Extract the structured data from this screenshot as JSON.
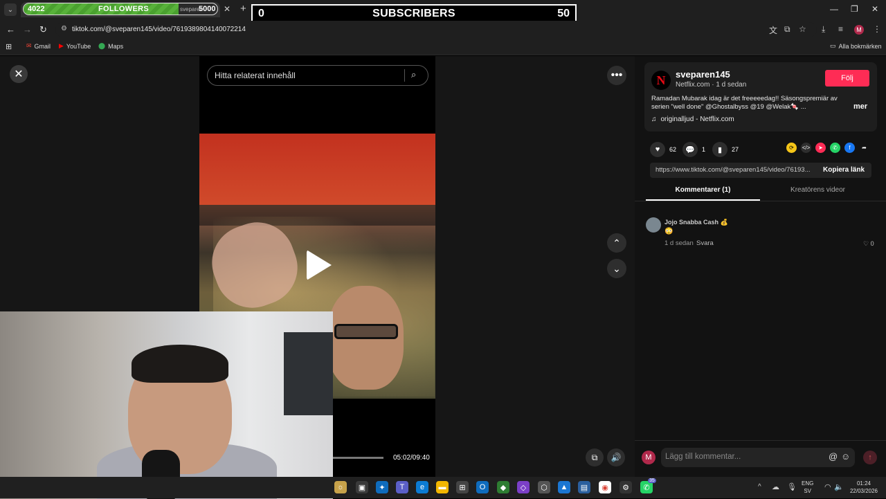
{
  "browser": {
    "overlay_followers": {
      "count": "4022",
      "label": "FOLLOWERS",
      "tab_ghost_text": "sveparen",
      "goal": "5000",
      "progress_fraction": 0.8
    },
    "overlay_subscribers": {
      "count": "0",
      "label": "SUBSCRIBERS",
      "goal": "50"
    },
    "url": "tiktok.com/@sveparen145/video/7619389804140072214",
    "bookmarks": [
      {
        "label": "Gmail",
        "icon": "gmail-icon"
      },
      {
        "label": "YouTube",
        "icon": "youtube-icon"
      },
      {
        "label": "Maps",
        "icon": "maps-icon"
      }
    ],
    "all_bookmarks": "Alla bokmärken",
    "profile_initial": "M"
  },
  "video": {
    "search_placeholder": "Hitta relaterat innehåll",
    "time": "05:02/09:40",
    "progress_fraction": 0.52
  },
  "post": {
    "username": "sveparen145",
    "subline": "Netflix.com · 1 d sedan",
    "follow_label": "Följ",
    "description": "Ramadan Mubarak idag är det freeeeedag!! Säsongspremiär av serien \"well done\" @Ghostalbyss @19 @Welak🍬 ...",
    "more_label": "mer",
    "music": "originalljud - Netflix.com",
    "likes": "62",
    "comments": "1",
    "saves": "27",
    "link": "https://www.tiktok.com/@sveparen145/video/76193...",
    "copy_link_label": "Kopiera länk",
    "tab_comments": "Kommentarer (1)",
    "tab_creator": "Kreatörens videor"
  },
  "comment_list": [
    {
      "name": "Jojo Snabba Cash 💰",
      "text": "😳",
      "time": "1 d sedan",
      "reply": "Svara",
      "likes": "0"
    }
  ],
  "comment_input": {
    "placeholder": "Lägg till kommentar...",
    "avatar_initial": "M"
  },
  "taskbar": {
    "lang": "ENG",
    "lang_sub": "SV",
    "clock_time": "01:24",
    "clock_date": "22/03/2026",
    "whatsapp_badge": "35"
  },
  "colors": {
    "tiktok_red": "#fe2c55",
    "netflix_red": "#e50914",
    "progress_green": "#58b23a"
  }
}
